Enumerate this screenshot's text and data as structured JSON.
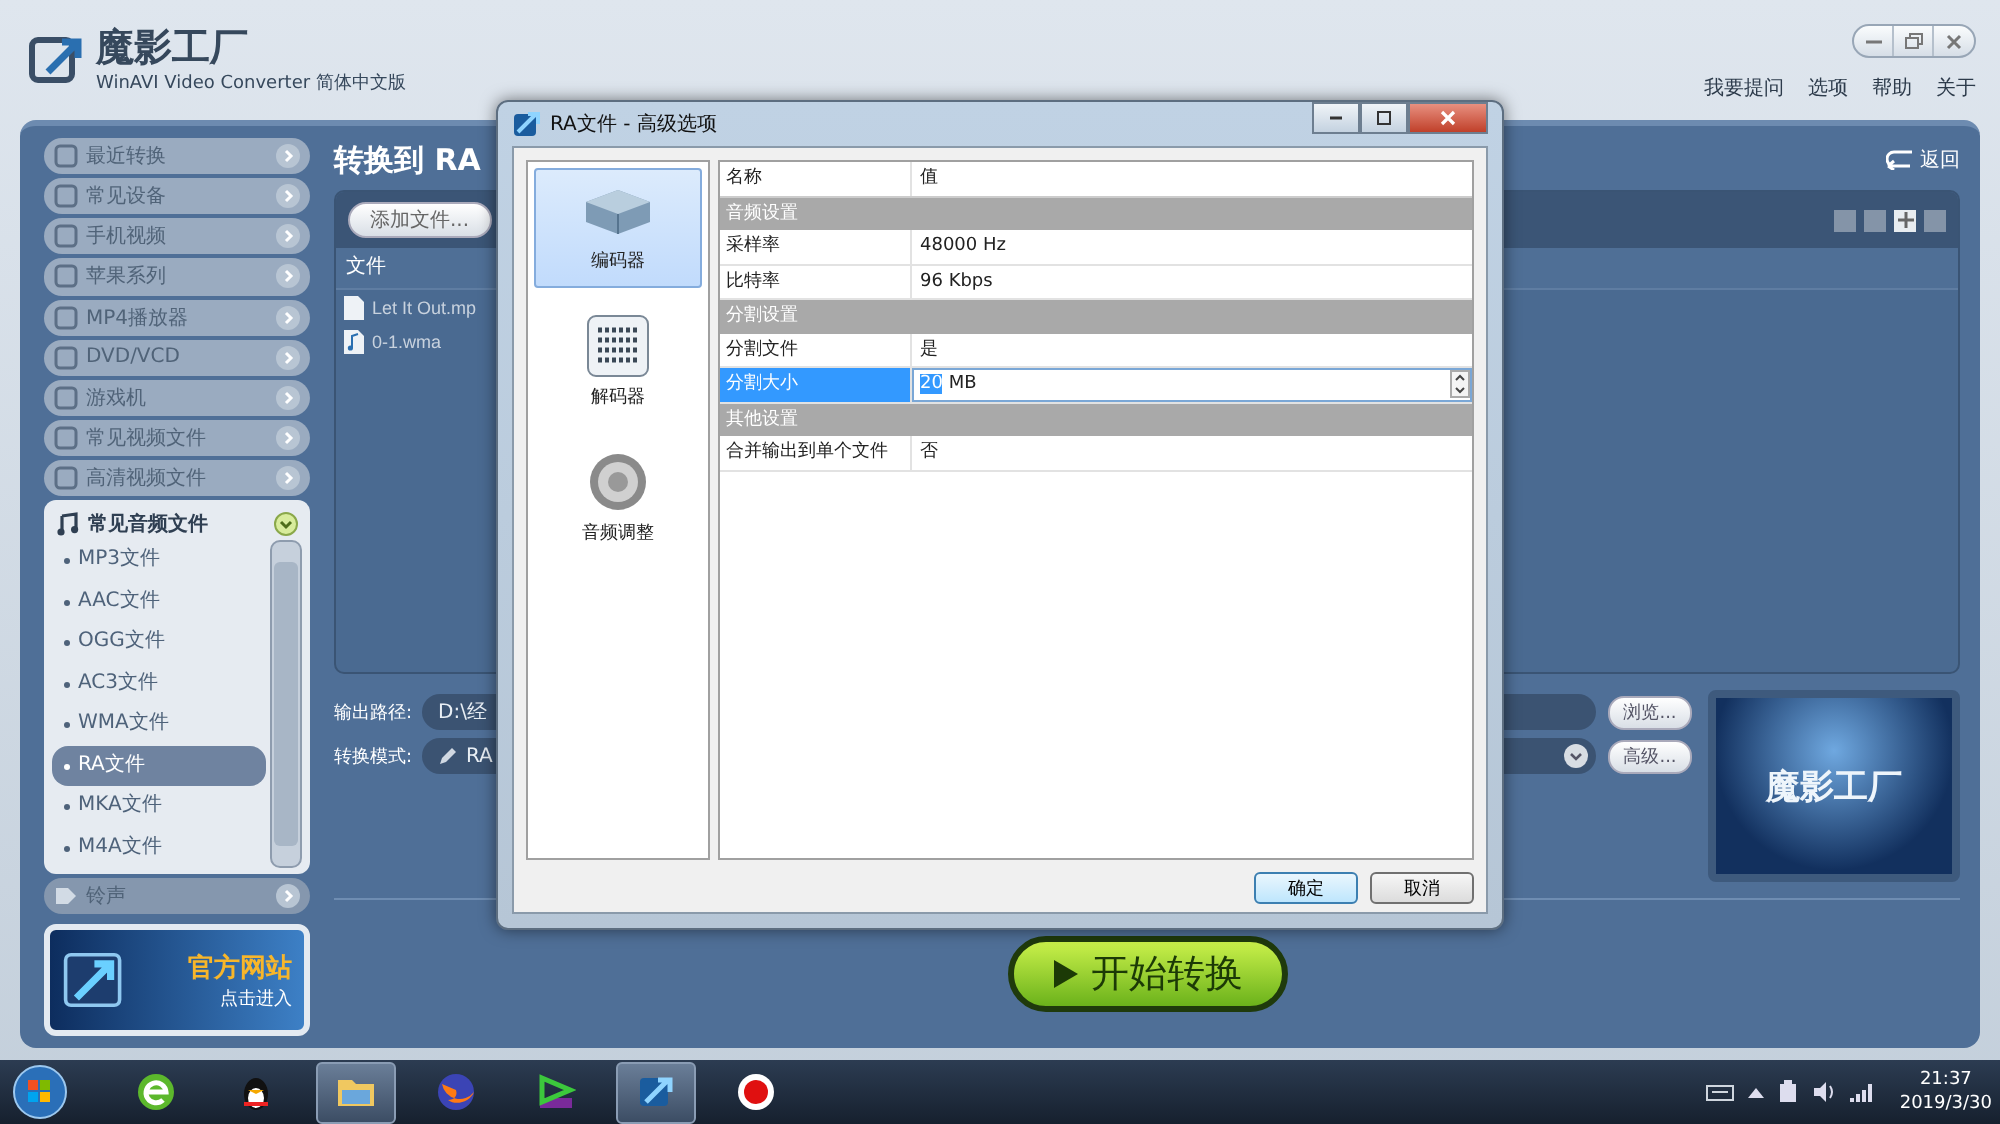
{
  "app": {
    "title": "魔影工厂",
    "subtitle": "WinAVI Video Converter 简体中文版",
    "menu": [
      "我要提问",
      "选项",
      "帮助",
      "关于"
    ]
  },
  "sidebar": {
    "categories": [
      {
        "label": "最近转换"
      },
      {
        "label": "常见设备"
      },
      {
        "label": "手机视频"
      },
      {
        "label": "苹果系列"
      },
      {
        "label": "MP4播放器"
      },
      {
        "label": "DVD/VCD"
      },
      {
        "label": "游戏机"
      },
      {
        "label": "常见视频文件"
      },
      {
        "label": "高清视频文件"
      }
    ],
    "group": {
      "label": "常见音频文件",
      "items": [
        {
          "label": "MP3文件",
          "selected": false
        },
        {
          "label": "AAC文件",
          "selected": false
        },
        {
          "label": "OGG文件",
          "selected": false
        },
        {
          "label": "AC3文件",
          "selected": false
        },
        {
          "label": "WMA文件",
          "selected": false
        },
        {
          "label": "RA文件",
          "selected": true
        },
        {
          "label": "MKA文件",
          "selected": false
        },
        {
          "label": "M4A文件",
          "selected": false
        }
      ]
    },
    "after": [
      {
        "label": "铃声"
      }
    ],
    "banner": {
      "title": "官方网站",
      "subtitle": "点击进入"
    }
  },
  "content": {
    "title": "转换到 RA",
    "back": "返回",
    "add_button": "添加文件...",
    "file_column": "文件",
    "files": [
      {
        "name": "Let It Out.mp",
        "kind": "document"
      },
      {
        "name": "0-1.wma",
        "kind": "audio"
      }
    ],
    "output_label": "输出路径:",
    "output_path": "D:\\经",
    "mode_label": "转换模式:",
    "mode_value": "RA",
    "browse": "浏览...",
    "advanced": "高级...",
    "preview_logo": "魔影工厂",
    "start": "开始转换"
  },
  "dialog": {
    "title": "RA文件 - 高级选项",
    "tools": [
      {
        "label": "编码器",
        "kind": "encoder",
        "selected": true
      },
      {
        "label": "解码器",
        "kind": "decoder",
        "selected": false
      },
      {
        "label": "音频调整",
        "kind": "speaker",
        "selected": false
      }
    ],
    "columns": [
      "名称",
      "值"
    ],
    "rows": [
      {
        "kind": "group",
        "name": "音频设置"
      },
      {
        "kind": "property",
        "name": "采样率",
        "value": "48000 Hz",
        "selected": false
      },
      {
        "kind": "property",
        "name": "比特率",
        "value": "96 Kbps",
        "selected": false
      },
      {
        "kind": "group",
        "name": "分割设置"
      },
      {
        "kind": "property",
        "name": "分割文件",
        "value": "是",
        "selected": false
      },
      {
        "kind": "editor",
        "name": "分割大小",
        "value": "20",
        "unit": "MB",
        "selected": true
      },
      {
        "kind": "group",
        "name": "其他设置"
      },
      {
        "kind": "property",
        "name": "合并输出到单个文件",
        "value": "否",
        "selected": false
      }
    ],
    "buttons": [
      "确定",
      "取消"
    ]
  },
  "taskbar": {
    "apps": [
      {
        "kind": "browser",
        "selected": false
      },
      {
        "kind": "penguin",
        "selected": false
      },
      {
        "kind": "folder",
        "selected": true
      },
      {
        "kind": "fox",
        "selected": false
      },
      {
        "kind": "play",
        "selected": false
      },
      {
        "kind": "converter",
        "selected": true
      },
      {
        "kind": "record",
        "selected": false
      }
    ],
    "time": "21:37",
    "date": "2019/3/30"
  }
}
